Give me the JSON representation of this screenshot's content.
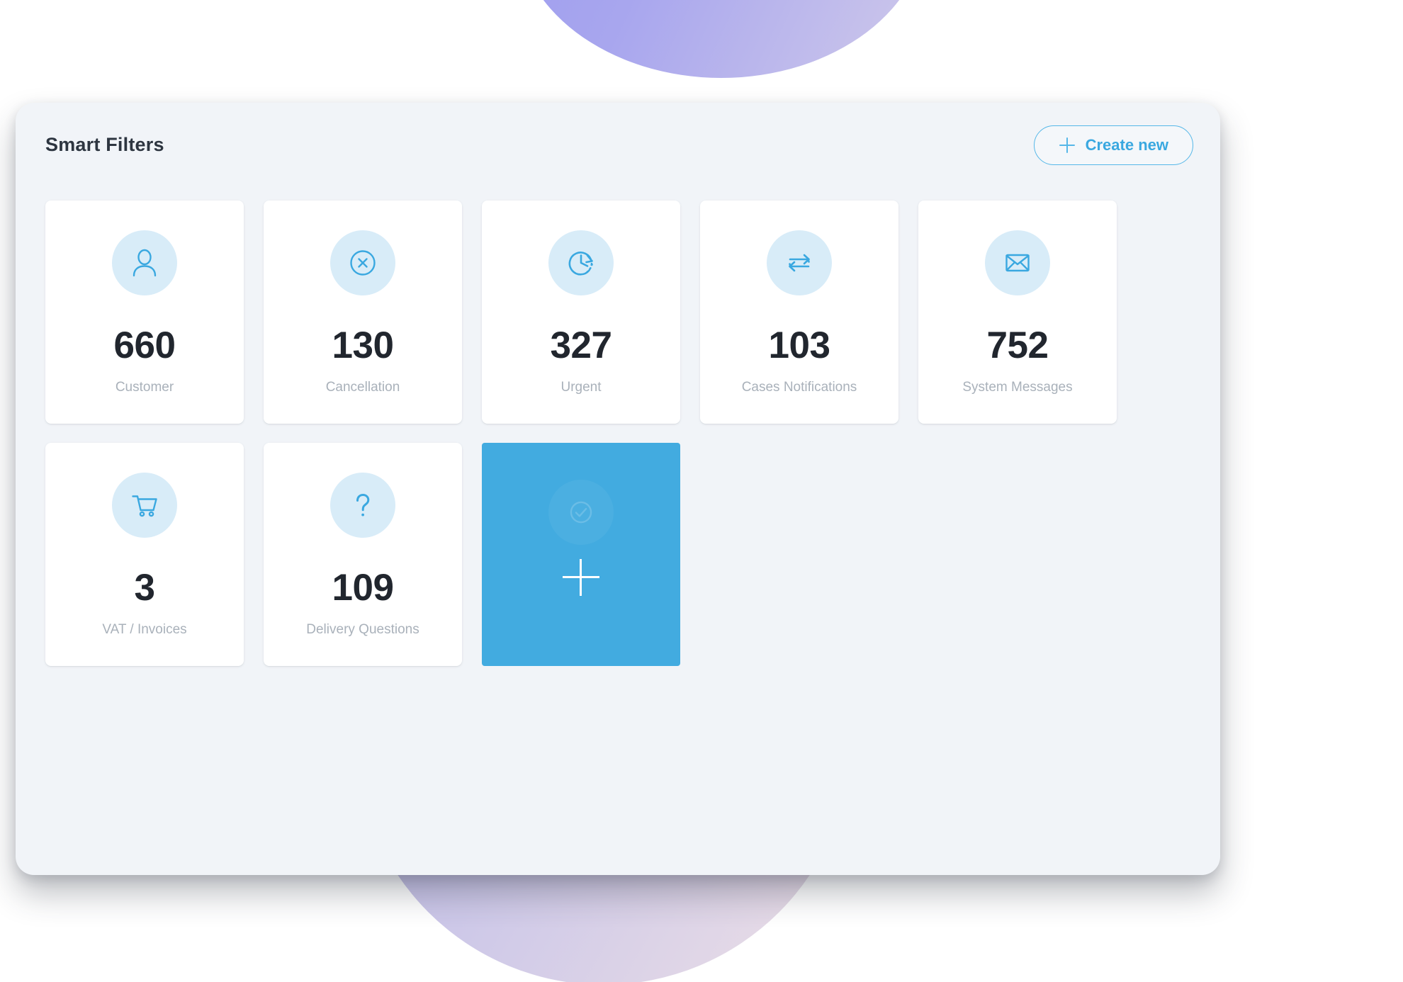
{
  "panel": {
    "title": "Smart Filters",
    "create_button": {
      "label": "Create new",
      "icon": "plus-icon"
    }
  },
  "colors": {
    "accent_blue": "#42abe0",
    "icon_blue": "#3aa8e0",
    "icon_circle_bg": "#d8ecf8",
    "panel_bg": "#f1f4f8",
    "tile_bg": "#ffffff",
    "count_text": "#21262e",
    "label_text": "#a9b1ba",
    "title_text": "#2d3540",
    "blob_purple": "#9b9bf0",
    "blob_lavender": "#cdc8e8"
  },
  "filters": [
    {
      "count": "660",
      "label": "Customer",
      "icon": "user-icon"
    },
    {
      "count": "130",
      "label": "Cancellation",
      "icon": "close-circle-icon"
    },
    {
      "count": "327",
      "label": "Urgent",
      "icon": "clock-history-icon"
    },
    {
      "count": "103",
      "label": "Cases Notifications",
      "icon": "exchange-arrows-icon"
    },
    {
      "count": "752",
      "label": "System Messages",
      "icon": "envelope-icon"
    },
    {
      "count": "3",
      "label": "VAT / Invoices",
      "icon": "shopping-cart-icon"
    },
    {
      "count": "109",
      "label": "Delivery Questions",
      "icon": "question-mark-icon"
    }
  ],
  "add_tile": {
    "icon": "plus-icon",
    "ghost_icon": "check-circle-icon"
  }
}
